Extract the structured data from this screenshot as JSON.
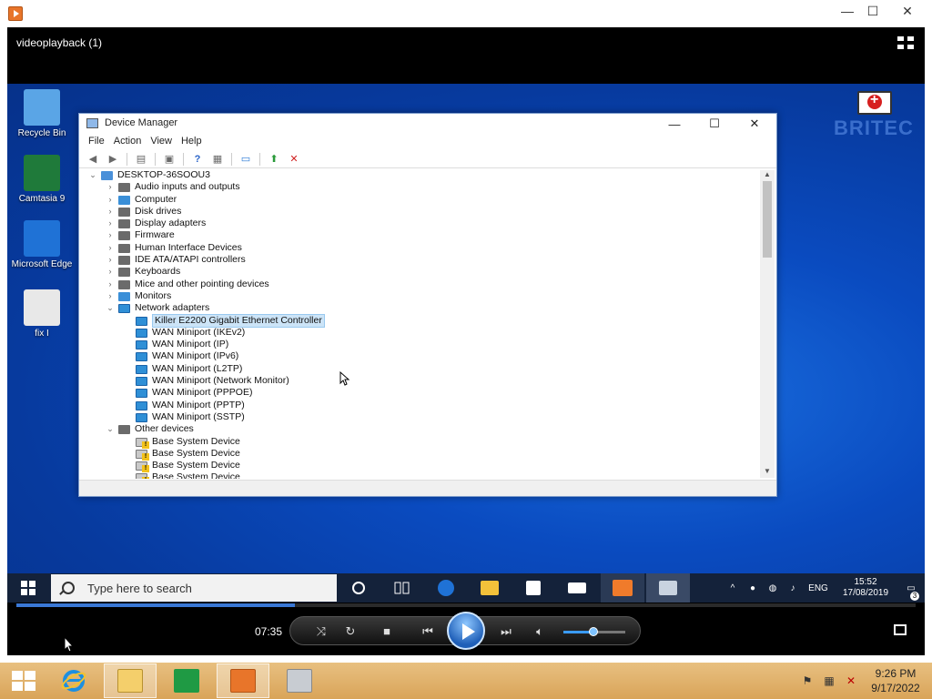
{
  "outer_window": {
    "title": "",
    "minimize": "—",
    "maximize": "☐",
    "close": "✕"
  },
  "player": {
    "video_title": "videoplayback (1)",
    "elapsed": "07:35",
    "seek_progress": 0.31,
    "volume": 0.48,
    "colors": {
      "seek_fill": "#3a78d6",
      "accent": "#1f5fb8"
    }
  },
  "desktop": {
    "icons": [
      {
        "label": "Recycle Bin",
        "icon": "recycle-bin-icon",
        "color": "#5aa5e6"
      },
      {
        "label": "Camtasia 9",
        "icon": "camtasia-icon",
        "color": "#1f7a3a"
      },
      {
        "label": "Microsoft Edge",
        "icon": "edge-icon",
        "color": "#1f72d6"
      },
      {
        "label": "fix I",
        "icon": "file-icon",
        "color": "#e8e8e8"
      }
    ],
    "brand_text": "BRITEC"
  },
  "device_manager": {
    "title": "Device Manager",
    "menu": [
      "File",
      "Action",
      "View",
      "Help"
    ],
    "root": "DESKTOP-36SOOU3",
    "categories": [
      {
        "label": "Audio inputs and outputs",
        "expanded": false,
        "icon": "device"
      },
      {
        "label": "Computer",
        "expanded": false,
        "icon": "computer"
      },
      {
        "label": "Disk drives",
        "expanded": false,
        "icon": "device"
      },
      {
        "label": "Display adapters",
        "expanded": false,
        "icon": "device"
      },
      {
        "label": "Firmware",
        "expanded": false,
        "icon": "device"
      },
      {
        "label": "Human Interface Devices",
        "expanded": false,
        "icon": "device"
      },
      {
        "label": "IDE ATA/ATAPI controllers",
        "expanded": false,
        "icon": "device"
      },
      {
        "label": "Keyboards",
        "expanded": false,
        "icon": "device"
      },
      {
        "label": "Mice and other pointing devices",
        "expanded": false,
        "icon": "device"
      },
      {
        "label": "Monitors",
        "expanded": false,
        "icon": "computer"
      },
      {
        "label": "Network adapters",
        "expanded": true,
        "icon": "net",
        "children": [
          "Killer E2200 Gigabit Ethernet Controller",
          "WAN Miniport (IKEv2)",
          "WAN Miniport (IP)",
          "WAN Miniport (IPv6)",
          "WAN Miniport (L2TP)",
          "WAN Miniport (Network Monitor)",
          "WAN Miniport (PPPOE)",
          "WAN Miniport (PPTP)",
          "WAN Miniport (SSTP)"
        ],
        "selected_child": 0
      },
      {
        "label": "Other devices",
        "expanded": true,
        "icon": "device",
        "children": [
          "Base System Device",
          "Base System Device",
          "Base System Device",
          "Base System Device"
        ],
        "child_icon": "warn"
      }
    ]
  },
  "win10_taskbar": {
    "search_placeholder": "Type here to search",
    "language": "ENG",
    "time": "15:52",
    "date": "17/08/2019",
    "notification_count": "3"
  },
  "host_taskbar": {
    "time": "9:26 PM",
    "date": "9/17/2022"
  }
}
